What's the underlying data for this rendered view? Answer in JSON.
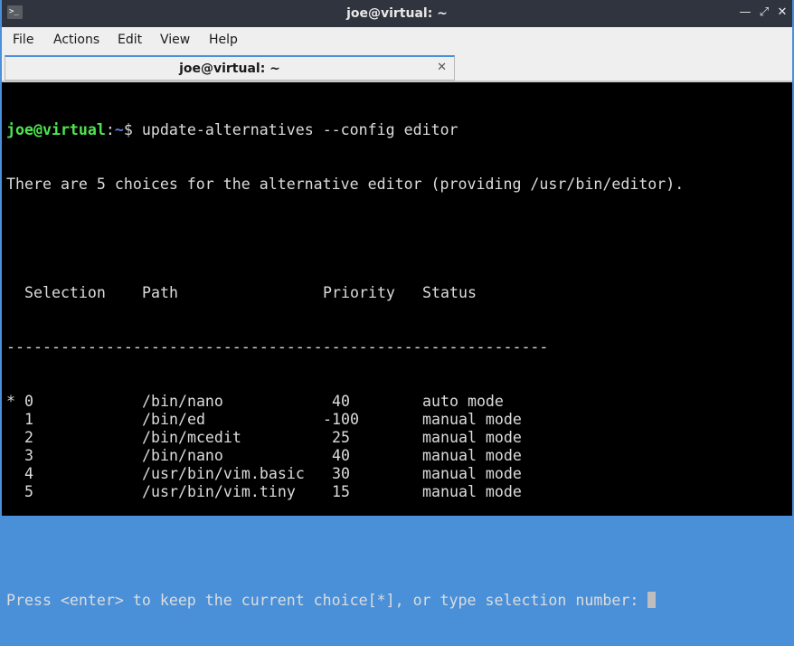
{
  "window": {
    "title": "joe@virtual: ~",
    "controls": [
      "minimize",
      "maximize",
      "close"
    ]
  },
  "menu": {
    "items": [
      "File",
      "Actions",
      "Edit",
      "View",
      "Help"
    ]
  },
  "tabs": [
    {
      "label": "joe@virtual: ~",
      "active": true
    }
  ],
  "terminal": {
    "prompt_user": "joe@virtual",
    "prompt_sep": ":",
    "prompt_path": "~",
    "prompt_symbol": "$ ",
    "command": "update-alternatives --config editor",
    "intro": "There are 5 choices for the alternative editor (providing /usr/bin/editor).",
    "table": {
      "headers": [
        "  Selection",
        "Path",
        "Priority",
        "Status"
      ],
      "separator": "------------------------------------------------------------",
      "rows": [
        {
          "marker": "*",
          "selection": "0",
          "path": "/bin/nano",
          "priority": "40",
          "status": "auto mode"
        },
        {
          "marker": " ",
          "selection": "1",
          "path": "/bin/ed",
          "priority": "-100",
          "status": "manual mode"
        },
        {
          "marker": " ",
          "selection": "2",
          "path": "/bin/mcedit",
          "priority": "25",
          "status": "manual mode"
        },
        {
          "marker": " ",
          "selection": "3",
          "path": "/bin/nano",
          "priority": "40",
          "status": "manual mode"
        },
        {
          "marker": " ",
          "selection": "4",
          "path": "/usr/bin/vim.basic",
          "priority": "30",
          "status": "manual mode"
        },
        {
          "marker": " ",
          "selection": "5",
          "path": "/usr/bin/vim.tiny",
          "priority": "15",
          "status": "manual mode"
        }
      ]
    },
    "input_prompt": "Press <enter> to keep the current choice[*], or type selection number: "
  },
  "colors": {
    "prompt_user": "#4ee64e",
    "prompt_path": "#5a7fd6",
    "accent": "#4a8fdc",
    "titlebar": "#2f343f"
  }
}
